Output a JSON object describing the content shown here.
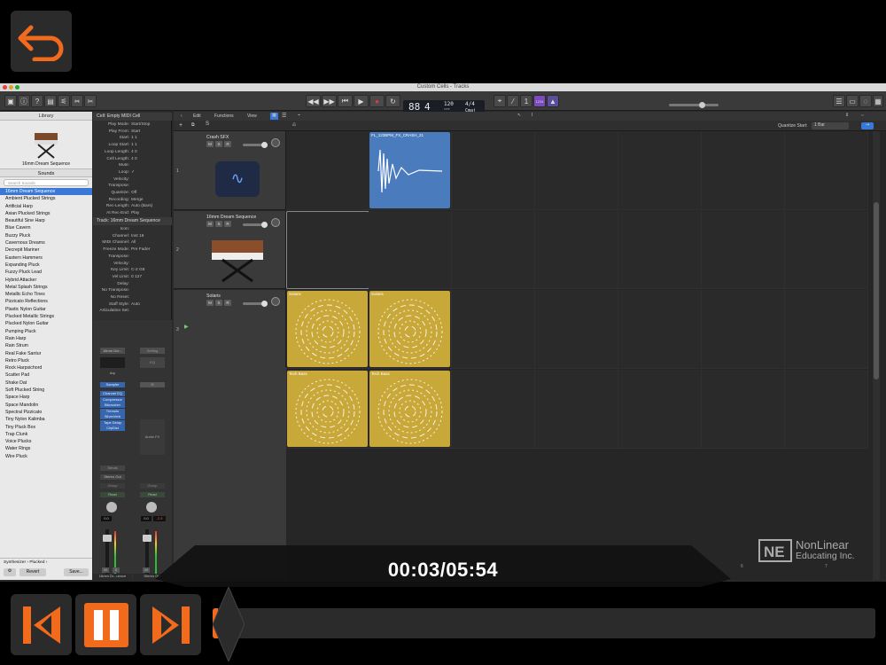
{
  "player": {
    "timecode": "00:03/05:54",
    "progress": 0.008,
    "brand_line1": "NonLinear",
    "brand_line2": "Educating Inc.",
    "accent_color": "#f26a1b"
  },
  "window": {
    "title": "Custom Cells - Tracks"
  },
  "lcd": {
    "bar": "88",
    "beat": "4",
    "bar_label": "BAR",
    "beat_label": "BEAT",
    "tempo": "120",
    "tempo_label": "KEEP",
    "tempo_sub": "TEMPO",
    "sig": "4/4",
    "key": "Cmaj",
    "counter": "1234"
  },
  "library": {
    "title": "Library",
    "preview_name": "16mm Dream Sequence",
    "section": "Sounds",
    "search_placeholder": "Search Sounds",
    "items": [
      "16mm Dream Sequence",
      "Ambient Plucked Strings",
      "Artificial Harp",
      "Asian Plucked Strings",
      "Beautiful Sine Harp",
      "Blue Cavern",
      "Buzzy Pluck",
      "Cavernous Dreams",
      "Decrepit Mariner",
      "Eastern Hammers",
      "Expanding Pluck",
      "Fuzzy Pluck Lead",
      "Hybrid Attacker",
      "Metal Splash Strings",
      "Metallic Echo Tines",
      "Pizzicato Reflections",
      "Plastic Nylon Guitar",
      "Plucked Metallic Strings",
      "Plucked Nylon Guitar",
      "Pumping Pluck",
      "Rain Harp",
      "Rain Strum",
      "Real Fake Santur",
      "Retro Pluck",
      "Rock Harpsichord",
      "Scatter Pad",
      "Shake Dat",
      "Soft Plucked String",
      "Space Harp",
      "Space Mandolin",
      "Spectral Pizzicato",
      "Tiny Nylon Kalimba",
      "Tiny Pluck Box",
      "Trap Clunk",
      "Voice Plucks",
      "Water Rings",
      "Wire Pluck"
    ],
    "selected_index": 0,
    "footer_path": "Synthesizer › Plucked ›",
    "revert": "Revert",
    "save": "Save..."
  },
  "inspector": {
    "cell_header": "Cell: Empty MIDI Cell",
    "cell_rows": [
      [
        "Play Mode:",
        "Start/Stop"
      ],
      [
        "Play From:",
        "Start"
      ],
      [
        "Start:",
        "1  1"
      ],
      [
        "Loop Start:",
        "1  1"
      ],
      [
        "Loop Length:",
        "4  0"
      ],
      [
        "Cell Length:",
        "4  0"
      ],
      [
        "Mute:",
        ""
      ],
      [
        "Loop:",
        "✓"
      ],
      [
        "Velocity:",
        ""
      ],
      [
        "Transpose:",
        ""
      ],
      [
        "Quantize:",
        "Off"
      ],
      [
        "Recording:",
        "Merge"
      ],
      [
        "Rec-Length:",
        "Auto (Bars)"
      ],
      [
        "At Rec-End:",
        "Play"
      ]
    ],
    "track_header": "Track: 16mm Dream Sequence",
    "track_rows": [
      [
        "Icon:",
        ""
      ],
      [
        "Channel:",
        "Inst 18"
      ],
      [
        "MIDI Channel:",
        "All"
      ],
      [
        "Freeze Mode:",
        "Pre Fader"
      ],
      [
        "Transpose:",
        ""
      ],
      [
        "Velocity:",
        ""
      ],
      [
        "Key Limit:",
        "C-2  G8"
      ],
      [
        "Vel Limit:",
        "0  127"
      ],
      [
        "Delay:",
        ""
      ],
      [
        "No Transpose:",
        ""
      ],
      [
        "No Reset:",
        ""
      ],
      [
        "Staff Style:",
        "Auto"
      ],
      [
        "Articulation Set:",
        ""
      ]
    ],
    "strip_name": "16mm Dre...",
    "strip_out": "Stereo Out",
    "plugins": [
      "Sampler",
      "Channel EQ",
      "Compressor",
      "Bitcrusher",
      "Tremolo",
      "SilverVerb",
      "Tape Delay",
      "ClipDist"
    ],
    "arp": "Arp",
    "setting_right": "Setting",
    "eq_right": "EQ",
    "audio_fx": "Audio FX",
    "sends": "Sends",
    "group": "Group",
    "read": "Read",
    "vol_left": "0.0",
    "vol_right": "0.0",
    "pan_right": "-2.5",
    "bounce": "Bnce",
    "strip_label_left": "16mm Dr...uence",
    "strip_label_right": "Stereo Out"
  },
  "tracks": {
    "menus": [
      "Edit",
      "Functions",
      "View"
    ],
    "quantize_start_label": "Quantize Start:",
    "quantize_start_value": "1 Bar",
    "rows": [
      {
        "num": "1",
        "name": "Crash SFX",
        "clips": [
          {
            "col": 1,
            "label": "FL_123BPM_FX_CRASH_21",
            "type": "audio"
          }
        ]
      },
      {
        "num": "2",
        "name": "16mm Dream Sequence",
        "clips": []
      },
      {
        "num": "3",
        "name": "Solaris",
        "clips": [
          {
            "col": 0,
            "label": "Solaris",
            "type": "pattern"
          },
          {
            "col": 1,
            "label": "Solaris",
            "type": "pattern"
          }
        ]
      },
      {
        "num": "20",
        "name": "Tech Bass",
        "clips": [
          {
            "col": 0,
            "label": "Tech Bass",
            "type": "pattern"
          },
          {
            "col": 1,
            "label": "Tech Bass",
            "type": "pattern"
          }
        ]
      }
    ],
    "col_footers": [
      "6",
      "7"
    ]
  },
  "colors": {
    "audio_clip": "#4a7bbd",
    "pattern_clip": "#c9a83a",
    "selection": "#3a78d6"
  }
}
